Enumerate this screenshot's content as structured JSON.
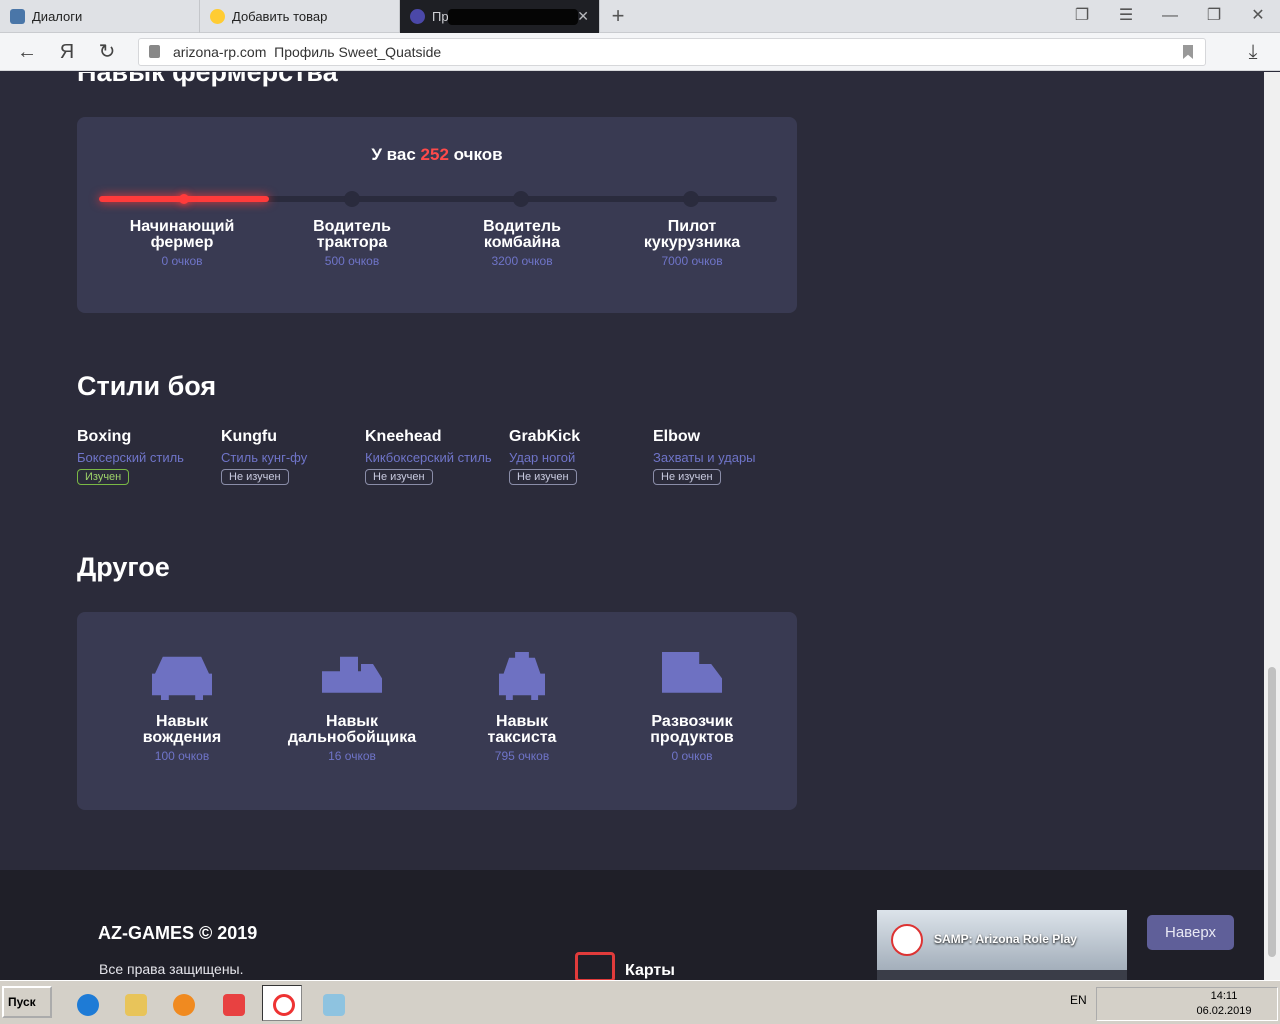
{
  "browser": {
    "tabs": [
      {
        "label": "Диалоги",
        "icon": "vk-icon"
      },
      {
        "label": "Добавить товар",
        "icon": "coin-icon"
      },
      {
        "label": "Пр",
        "icon": "arizona-icon"
      }
    ],
    "url_domain": "arizona-rp.com",
    "url_title": "Профиль Sweet_Quatside"
  },
  "farming": {
    "heading": "Навык фермерства",
    "points_prefix": "У вас",
    "points_value": "252",
    "points_suffix": "очков",
    "progress_fraction": 0.25,
    "accent_color": "#ff3b3b",
    "levels": [
      {
        "name": "Начинающий фермер",
        "points": "0 очков"
      },
      {
        "name": "Водитель трактора",
        "points": "500 очков"
      },
      {
        "name": "Водитель комбайна",
        "points": "3200 очков"
      },
      {
        "name": "Пилот кукурузника",
        "points": "7000 очков"
      }
    ]
  },
  "fighting": {
    "heading": "Стили боя",
    "styles": [
      {
        "name": "Boxing",
        "desc": "Боксерский стиль",
        "status": "Изучен",
        "learned": true
      },
      {
        "name": "Kungfu",
        "desc": "Стиль кунг-фу",
        "status": "Не изучен",
        "learned": false
      },
      {
        "name": "Kneehead",
        "desc": "Кикбоксерский стиль",
        "status": "Не изучен",
        "learned": false
      },
      {
        "name": "GrabKick",
        "desc": "Удар ногой",
        "status": "Не изучен",
        "learned": false
      },
      {
        "name": "Elbow",
        "desc": "Захваты и удары",
        "status": "Не изучен",
        "learned": false
      }
    ]
  },
  "other": {
    "heading": "Другое",
    "skills": [
      {
        "name_line1": "Навык",
        "name_line2": "вождения",
        "points": "100 очков",
        "icon": "car-icon"
      },
      {
        "name_line1": "Навык",
        "name_line2": "дальнобойщика",
        "points": "16 очков",
        "icon": "truck-icon"
      },
      {
        "name_line1": "Навык",
        "name_line2": "таксиста",
        "points": "795 очков",
        "icon": "taxi-icon"
      },
      {
        "name_line1": "Развозчик",
        "name_line2": "продуктов",
        "points": "0 очков",
        "icon": "van-icon"
      }
    ]
  },
  "footer": {
    "copyright": "AZ-GAMES © 2019",
    "rights": "Все права защищены.",
    "maps_label": "Карты",
    "widget_title": "SAMP: Arizona Role Play",
    "to_top": "Наверх"
  },
  "taskbar": {
    "start": "Пуск",
    "lang": "EN",
    "time": "14:11",
    "date": "06.02.2019"
  }
}
